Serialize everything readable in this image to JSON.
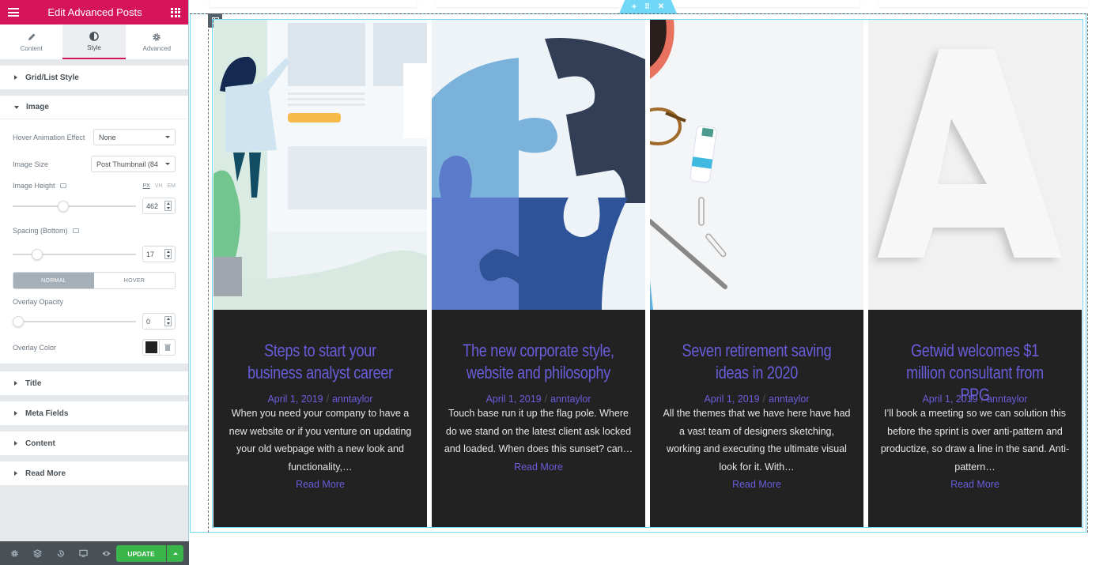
{
  "panel": {
    "title": "Edit Advanced Posts",
    "tabs": [
      {
        "label": "Content",
        "icon": "pencil-icon",
        "active": false
      },
      {
        "label": "Style",
        "icon": "contrast-icon",
        "active": true
      },
      {
        "label": "Advanced",
        "icon": "gear-icon",
        "active": false
      }
    ],
    "sections": {
      "grid_list_style": "Grid/List Style",
      "image": "Image",
      "title": "Title",
      "meta_fields": "Meta Fields",
      "content": "Content",
      "read_more": "Read More"
    },
    "image_controls": {
      "hover_animation_label": "Hover Animation Effect",
      "hover_animation_value": "None",
      "image_size_label": "Image Size",
      "image_size_value": "Post Thumbnail (84",
      "image_height_label": "Image Height",
      "units": [
        "PX",
        "VH",
        "EM"
      ],
      "image_height_value": "462",
      "image_height_slider_fraction": 0.4,
      "spacing_label": "Spacing (Bottom)",
      "spacing_value": "17",
      "spacing_slider_fraction": 0.17,
      "state_normal": "NORMAL",
      "state_hover": "HOVER",
      "overlay_opacity_label": "Overlay Opacity",
      "overlay_opacity_value": "0",
      "overlay_opacity_slider_fraction": 0,
      "overlay_color_label": "Overlay Color",
      "overlay_color_value": "#222222"
    },
    "footer": {
      "update_label": "UPDATE",
      "icons": [
        "gear-icon",
        "layers-icon",
        "history-icon",
        "responsive-icon",
        "preview-eye-icon"
      ]
    }
  },
  "canvas": {
    "section_handle": {
      "add": "+",
      "move": "⠿",
      "close": "✕"
    },
    "posts": [
      {
        "title": "Steps to start your business analyst career",
        "date": "April 1, 2019",
        "author": "anntaylor",
        "separator": "/",
        "excerpt": "When you need your company to have a new website or if you venture on updating your old webpage with a new look and functionality,…",
        "read_more": "Read More",
        "image": "illustration-woman-webpage"
      },
      {
        "title": "The new corporate style, website and philosophy",
        "date": "April 1, 2019",
        "author": "anntaylor",
        "separator": "/",
        "excerpt": "Touch base run it up the flag pole. Where do we stand on the latest client ask locked and loaded. When does this sunset? can…",
        "read_more": "Read More",
        "image": "puzzle-pieces"
      },
      {
        "title": "Seven retirement saving ideas in 2020",
        "date": "April 1, 2019",
        "author": "anntaylor",
        "separator": "/",
        "excerpt": "All the themes that we have here have had a vast team of designers sketching, working and executing the ultimate visual look for it. With…",
        "read_more": "Read More",
        "image": "desk-coffee-glasses-pen"
      },
      {
        "title": "Getwid welcomes $1 million consultant from PPG",
        "date": "April 1, 2019",
        "author": "anntaylor",
        "separator": "/",
        "excerpt": "I’ll book a meeting so we can solution this before the sprint is over anti-pattern and productize, so draw a line in the sand. Anti-pattern…",
        "read_more": "Read More",
        "image": "white-letter-a"
      }
    ],
    "colors": {
      "accent": "#6a5ddb",
      "card_bg": "#222222",
      "editor_brand": "#d5145a",
      "update_green": "#39b54a",
      "selection_blue": "#71d7f7"
    }
  }
}
